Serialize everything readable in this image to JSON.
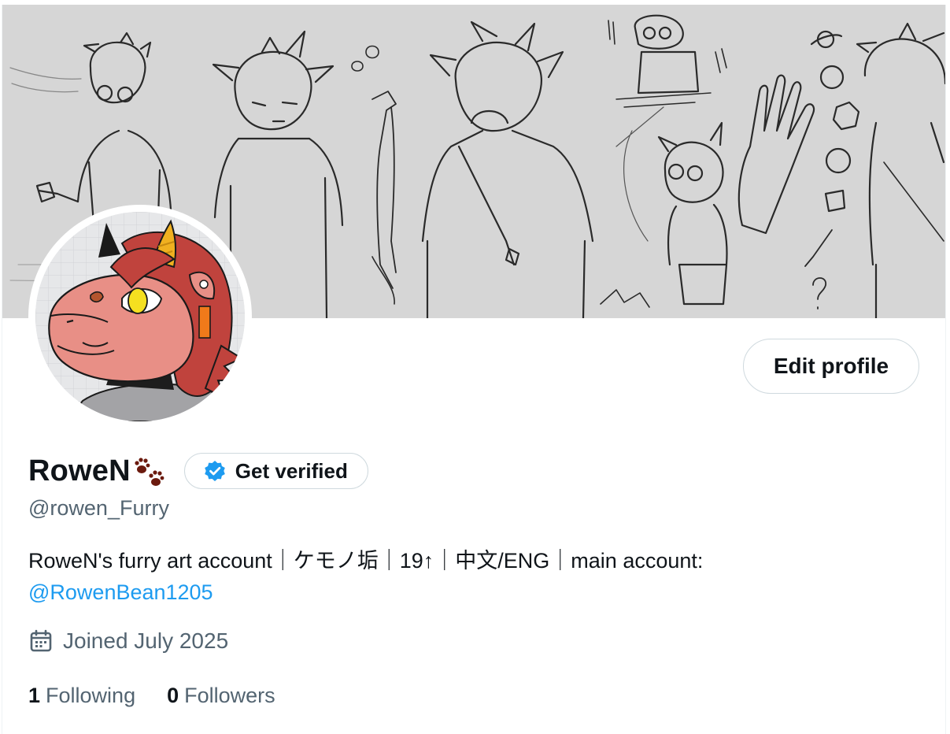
{
  "profile": {
    "display_name": "RoweN",
    "handle": "@rowen_Furry",
    "verify_label": "Get verified",
    "edit_label": "Edit profile",
    "bio_text": "RoweN's furry art account｜ケモノ垢｜19↑｜中文/ENG｜main account: ",
    "bio_mention": "@RowenBean1205",
    "joined": "Joined July 2025",
    "following_count": "1",
    "following_label": "Following",
    "followers_count": "0",
    "followers_label": "Followers"
  },
  "icons": {
    "name_emoji": "paw-prints-icon",
    "verify": "verified-badge-icon",
    "joined": "calendar-icon"
  },
  "colors": {
    "accent": "#1d9bf0",
    "muted_text": "#536471",
    "banner_bg": "#d6d6d6",
    "paw": "#6b1a0e",
    "avatar_skin": "#e88f86",
    "avatar_hair": "#c0433d",
    "avatar_horn": "#f0b020"
  }
}
